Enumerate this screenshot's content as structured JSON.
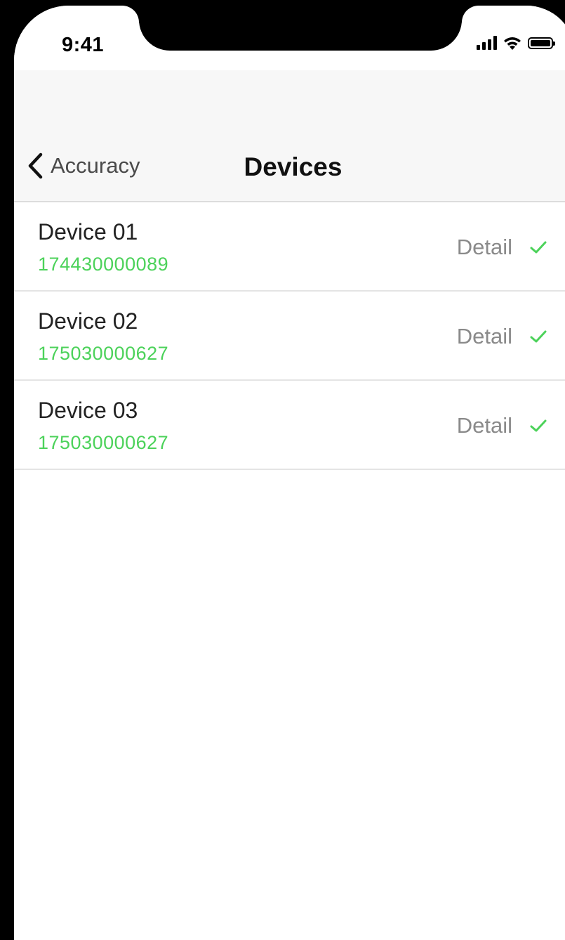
{
  "status_bar": {
    "time": "9:41",
    "icons": [
      "cellular-signal-icon",
      "wifi-icon",
      "battery-icon"
    ]
  },
  "nav": {
    "back_label": "Accuracy",
    "title": "Devices"
  },
  "devices": [
    {
      "name": "Device 01",
      "serial": "174430000089",
      "action": "Detail"
    },
    {
      "name": "Device 02",
      "serial": "175030000627",
      "action": "Detail"
    },
    {
      "name": "Device 03",
      "serial": "175030000627",
      "action": "Detail"
    }
  ],
  "colors": {
    "accent_green": "#4cd25a",
    "nav_background": "#f7f7f7",
    "detail_gray": "#8a8a8a"
  }
}
